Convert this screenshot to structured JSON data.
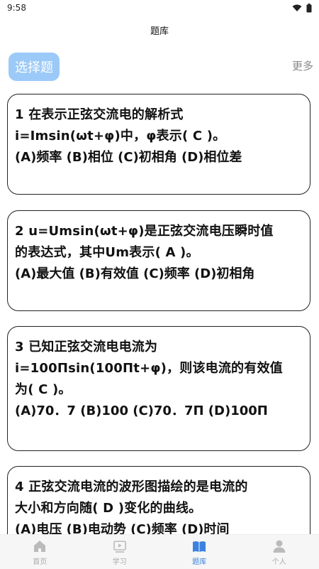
{
  "status_bar": {
    "time": "9:58"
  },
  "header": {
    "title": "题库"
  },
  "category": {
    "chip_label": "选择题",
    "more_label": "更多"
  },
  "questions": [
    {
      "text": "1 在表示正弦交流电的解析式\ni=Imsin(ωt+φ)中，φ表示( C )。",
      "options": "(A)频率 (B)相位 (C)初相角 (D)相位差"
    },
    {
      "text": "2 u=Umsin(ωt+φ)是正弦交流电压瞬时值\n的表达式，其中Um表示( A )。",
      "options": "(A)最大值 (B)有效值 (C)频率 (D)初相角"
    },
    {
      "text": "3 已知正弦交流电电流为\ni=100Πsin(100Πt+φ)，则该电流的有效值\n为( C )。",
      "options": "(A)70．7 (B)100 (C)70．7Π (D)100Π"
    },
    {
      "text": "4 正弦交流电流的波形图描绘的是电流的\n大小和方向随( D )变化的曲线。",
      "options": "(A)电压 (B)电动势 (C)频率 (D)时间"
    }
  ],
  "nav": [
    {
      "label": "首页",
      "icon": "home-icon"
    },
    {
      "label": "学习",
      "icon": "video-icon"
    },
    {
      "label": "题库",
      "icon": "book-icon",
      "active": true
    },
    {
      "label": "个人",
      "icon": "person-icon"
    }
  ],
  "colors": {
    "accent": "#3b82e0",
    "chip": "#9ccaf8",
    "nav_inactive": "#aaaaaa"
  }
}
